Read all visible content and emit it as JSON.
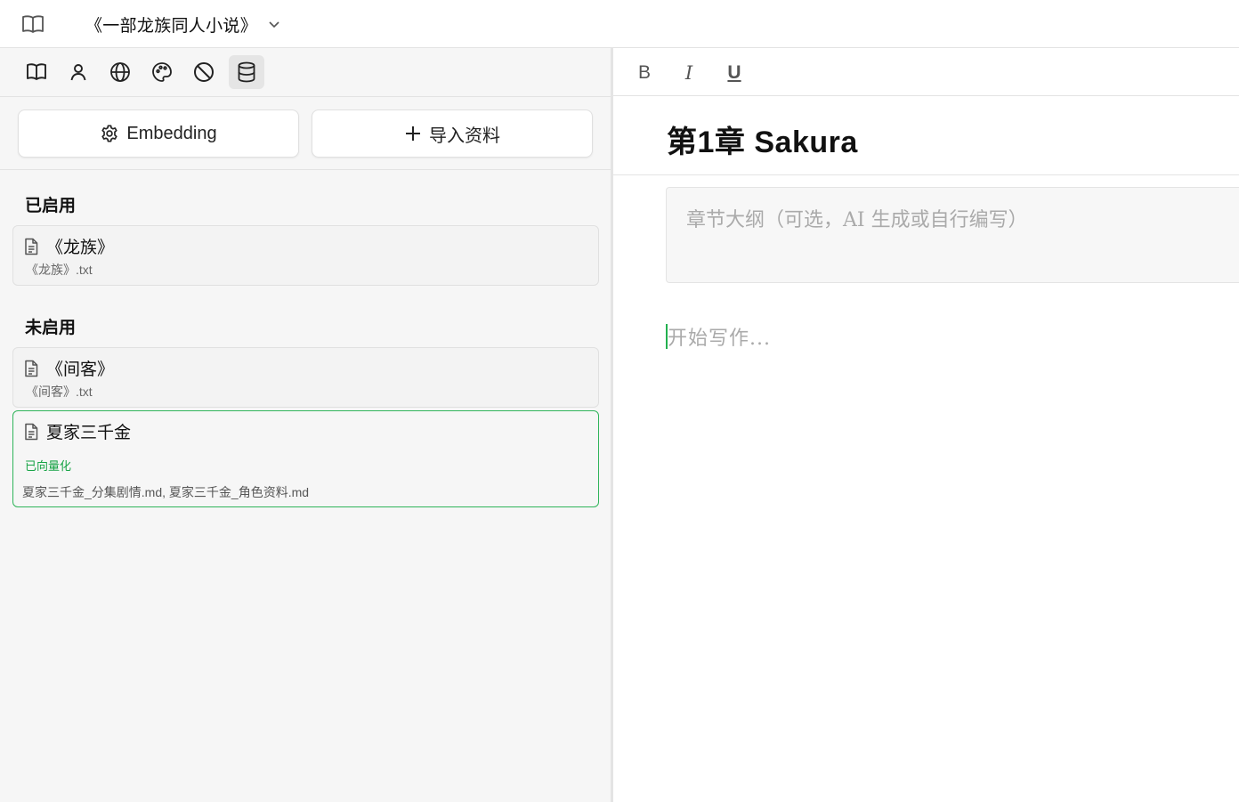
{
  "topbar": {
    "book_title": "《一部龙族同人小说》"
  },
  "left_toolbar": {
    "tools": [
      {
        "icon": "book-open-icon"
      },
      {
        "icon": "user-icon"
      },
      {
        "icon": "globe-icon"
      },
      {
        "icon": "palette-icon"
      },
      {
        "icon": "ban-icon"
      },
      {
        "icon": "database-icon",
        "active": true
      }
    ]
  },
  "actions": {
    "embedding_label": "Embedding",
    "import_label": "导入资料"
  },
  "enabled": {
    "heading": "已启用",
    "items": [
      {
        "name": "《龙族》",
        "file": "《龙族》.txt"
      }
    ]
  },
  "disabled": {
    "heading": "未启用",
    "items": [
      {
        "name": "《间客》",
        "file": "《间客》.txt"
      },
      {
        "name": "夏家三千金",
        "status": "已向量化",
        "files": "夏家三千金_分集剧情.md, 夏家三千金_角色资料.md"
      }
    ]
  },
  "editor": {
    "format": {
      "bold": "B",
      "italic": "I",
      "underline": "U"
    },
    "chapter_title": "第1章 Sakura",
    "outline_placeholder": "章节大纲（可选，AI 生成或自行编写）",
    "body_placeholder": "开始写作..."
  },
  "colors": {
    "accent_green": "#22b04f",
    "panel_bg": "#f6f6f6"
  }
}
